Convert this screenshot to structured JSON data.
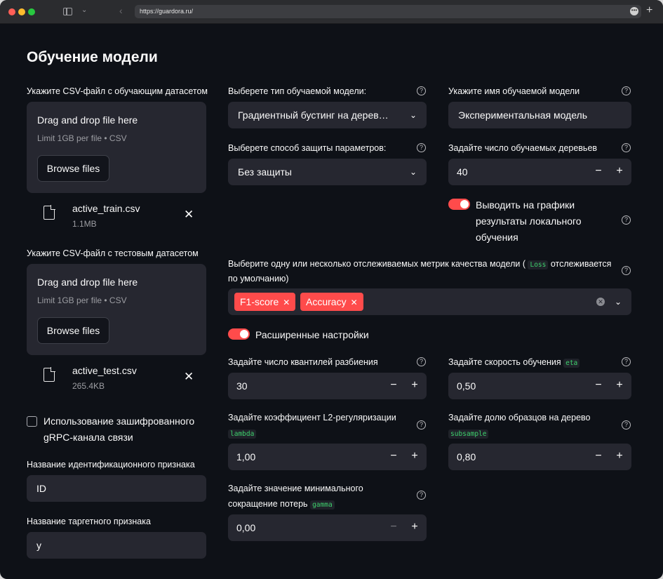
{
  "browser": {
    "url": "https://guardora.ru/"
  },
  "title": "Обучение модели",
  "train": {
    "label": "Укажите CSV-файл с обучающим датасетом",
    "drop_text": "Drag and drop file here",
    "limit_text": "Limit 1GB per file • CSV",
    "browse_label": "Browse files",
    "file_name": "active_train.csv",
    "file_size": "1.1MB"
  },
  "test": {
    "label": "Укажите CSV-файл с тестовым датасетом",
    "drop_text": "Drag and drop file here",
    "limit_text": "Limit 1GB per file • CSV",
    "browse_label": "Browse files",
    "file_name": "active_test.csv",
    "file_size": "265.4KB"
  },
  "grpc": {
    "label_line1": "Использование зашифрованного",
    "label_line2": "gRPC-канала связи",
    "checked": false
  },
  "id_feature": {
    "label": "Название идентификационного признака",
    "value": "ID"
  },
  "target_feature": {
    "label": "Название таргетного признака",
    "value": "y"
  },
  "model_type": {
    "label": "Выберете тип обучаемой модели:",
    "value": "Градиентный бустинг на дерев…"
  },
  "protection": {
    "label": "Выберете способ защиты параметров:",
    "value": "Без защиты"
  },
  "model_name": {
    "label": "Укажите имя обучаемой модели",
    "value": "Экспериментальная модель"
  },
  "trees": {
    "label": "Задайте число обучаемых деревьев",
    "value": "40"
  },
  "local_results": {
    "line1": "Выводить на графики",
    "line2": "результаты локального",
    "line3": "обучения",
    "on": true
  },
  "metrics": {
    "label_before": "Выберите одну или несколько отслеживаемых метрик качества модели (",
    "label_code": "Loss",
    "label_after": "отслеживается",
    "label_line2": "по умолчанию)",
    "tags": [
      "F1-score",
      "Accuracy"
    ]
  },
  "advanced": {
    "label": "Расширенные настройки",
    "on": true
  },
  "quantiles": {
    "label": "Задайте число квантилей разбиения",
    "value": "30"
  },
  "eta": {
    "label": "Задайте скорость обучения",
    "code": "eta",
    "value": "0,50"
  },
  "l2": {
    "label": "Задайте коэффициент L2-регуляризации",
    "code": "lambda",
    "value": "1,00"
  },
  "subsample": {
    "label": "Задайте долю образцов на дерево",
    "code": "subsample",
    "value": "0,80"
  },
  "gamma": {
    "label_line1": "Задайте значение минимального",
    "label_line2": "сокращение потерь",
    "code": "gamma",
    "value": "0,00"
  },
  "icons": {
    "minus": "−",
    "plus": "+",
    "help": "?",
    "close": "✕",
    "chevron": "⌄"
  }
}
